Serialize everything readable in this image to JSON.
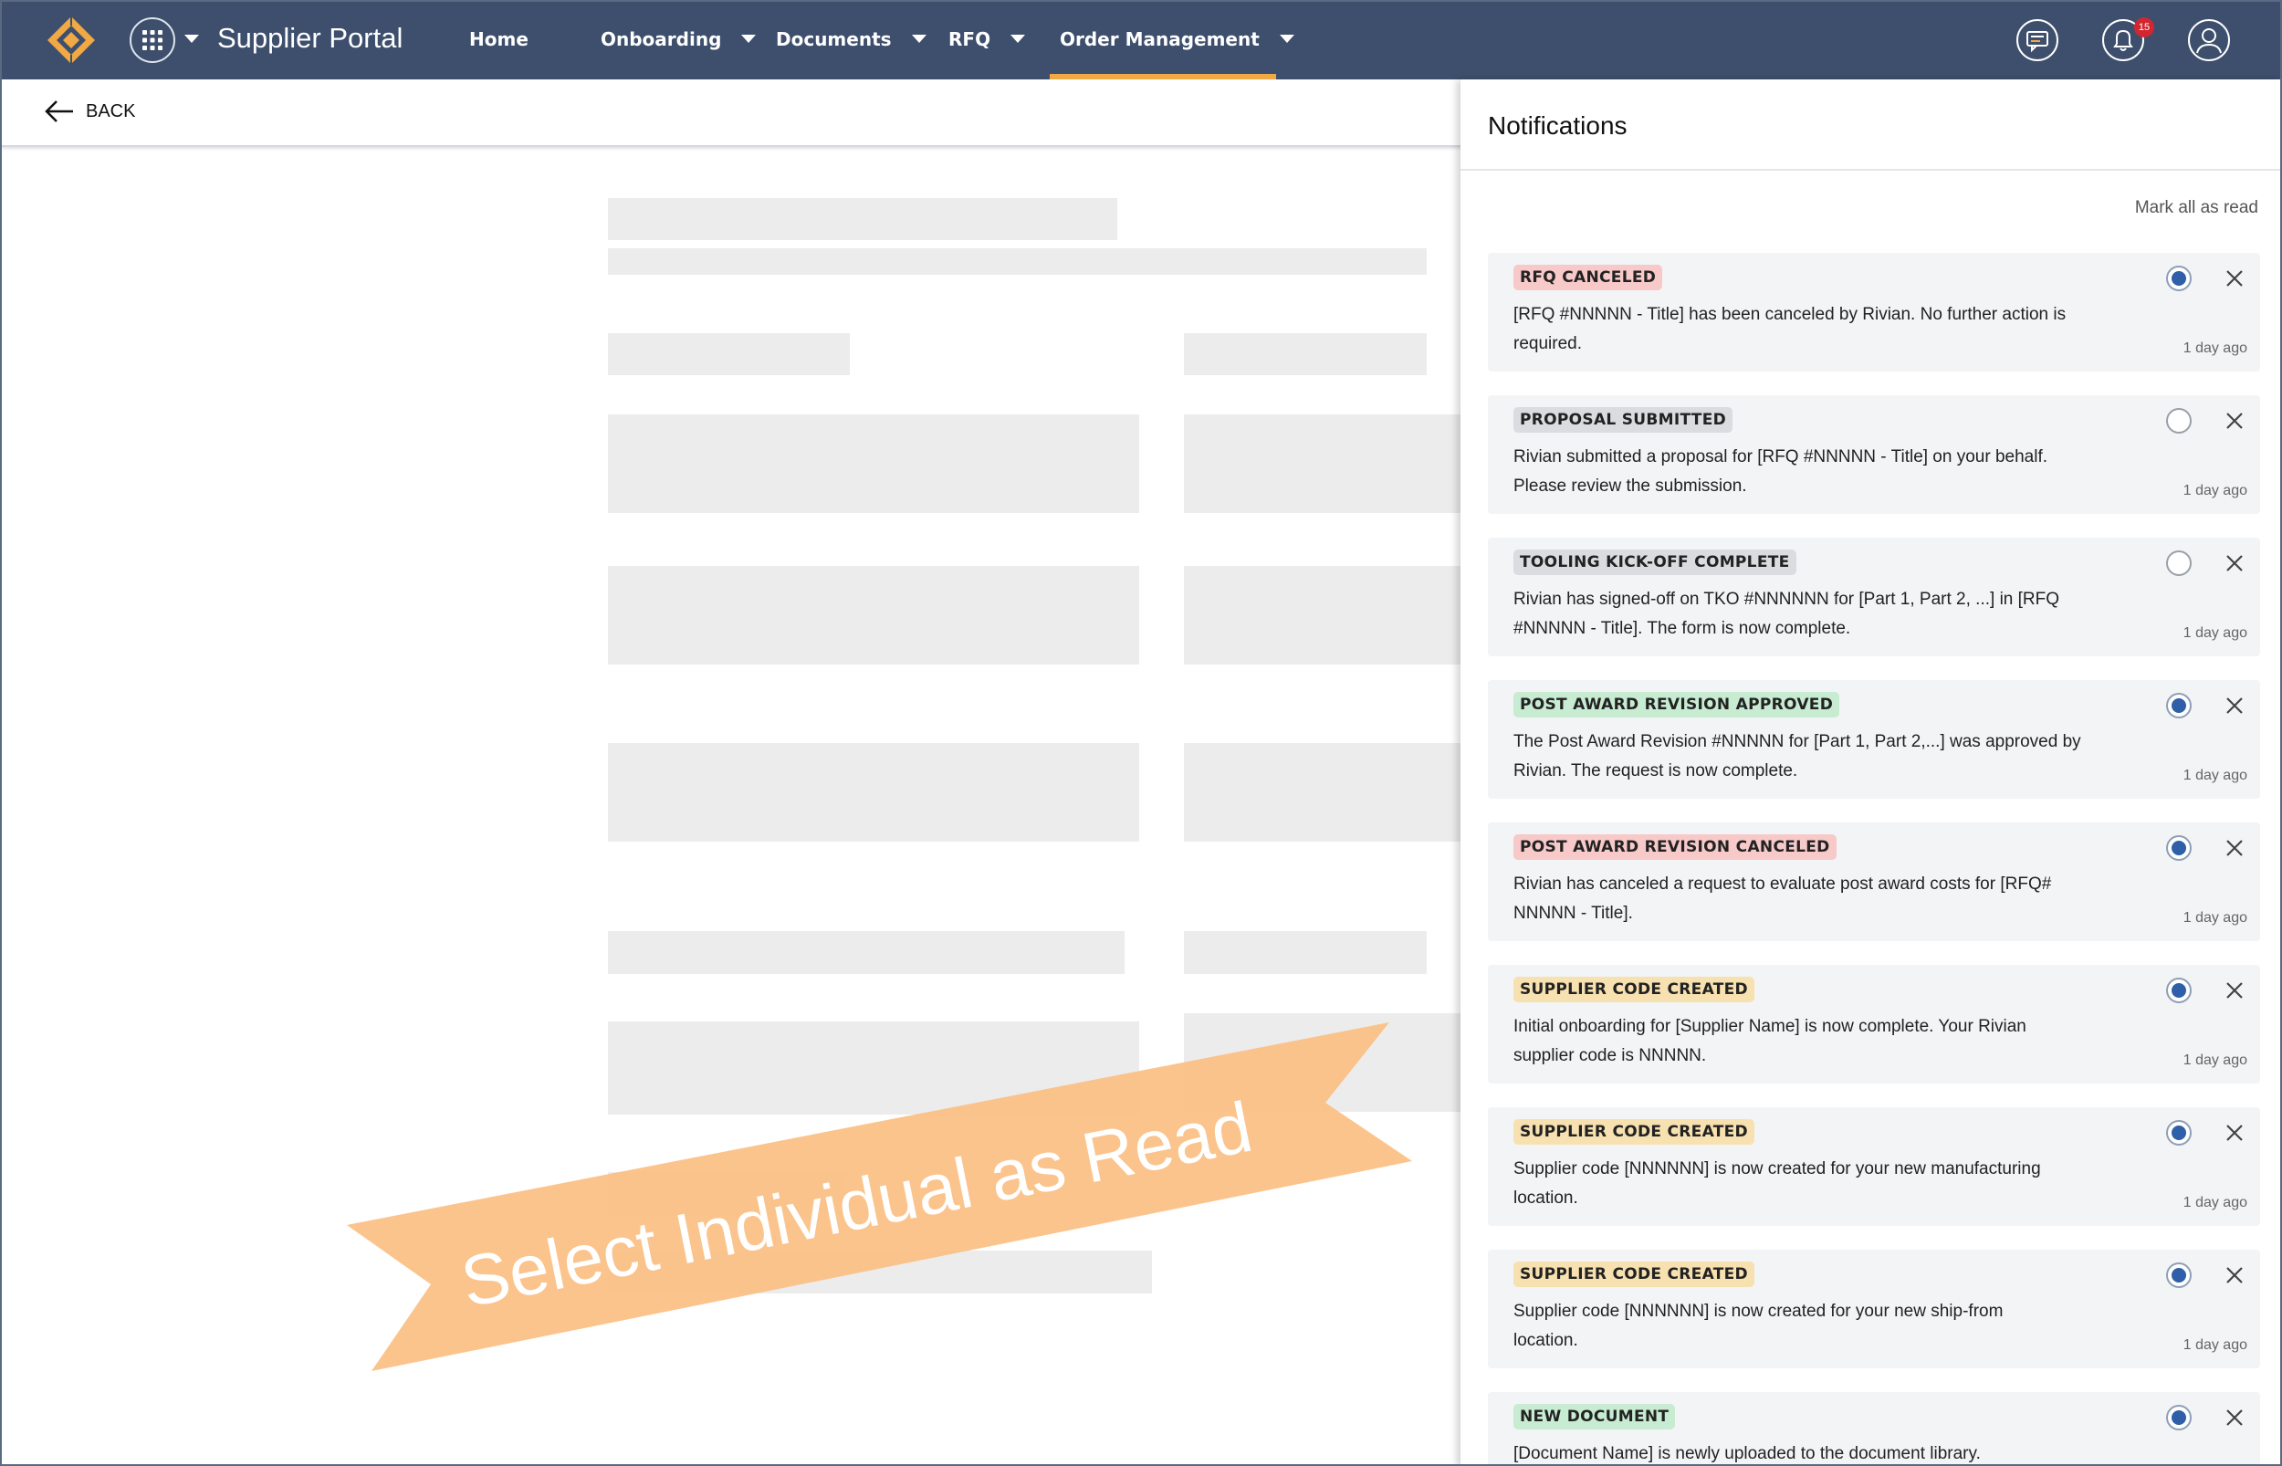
{
  "header": {
    "app_title": "Supplier Portal",
    "nav": [
      "Home",
      "Onboarding",
      "Documents",
      "RFQ",
      "Order Management"
    ],
    "notification_count": "15",
    "accent": "#f0a944",
    "bar_color": "#3d4f6c"
  },
  "subbar": {
    "back_label": "BACK"
  },
  "banner": {
    "text": "Select Individual as Read",
    "color": "#fbbf84"
  },
  "notifications": {
    "title": "Notifications",
    "mark_all": "Mark all as read",
    "items": [
      {
        "tag": "RFQ CANCELED",
        "tag_color": "#f7c9c9",
        "line1": "[RFQ #NNNNN - Title] has been canceled by Rivian. No further action is",
        "line2": "required.",
        "time": "1 day ago",
        "selected": true
      },
      {
        "tag": "PROPOSAL SUBMITTED",
        "tag_color": "#dadcdf",
        "line1": "Rivian submitted a proposal for [RFQ #NNNNN - Title] on your behalf.",
        "line2": "Please review the submission.",
        "time": "1 day ago",
        "selected": false
      },
      {
        "tag": "TOOLING KICK-OFF COMPLETE",
        "tag_color": "#dadcdf",
        "line1": "Rivian has signed-off on TKO #NNNNNN for [Part 1, Part 2, ...] in [RFQ",
        "line2": "#NNNNN - Title]. The form is now complete.",
        "time": "1 day ago",
        "selected": false
      },
      {
        "tag": "POST AWARD REVISION APPROVED",
        "tag_color": "#c8ecd2",
        "line1": "The Post Award Revision #NNNNN for [Part 1, Part 2,...] was approved by",
        "line2": "Rivian. The request is now complete.",
        "time": "1 day ago",
        "selected": true
      },
      {
        "tag": "POST AWARD REVISION CANCELED",
        "tag_color": "#f7c9c9",
        "line1": "Rivian has canceled a request to evaluate post award costs for [RFQ#",
        "line2": "NNNNN - Title].",
        "time": "1 day ago",
        "selected": true
      },
      {
        "tag": "SUPPLIER CODE CREATED",
        "tag_color": "#f8e1b0",
        "line1": "Initial onboarding for [Supplier Name] is now complete. Your Rivian",
        "line2": "supplier code is NNNNN.",
        "time": "1 day ago",
        "selected": true
      },
      {
        "tag": "SUPPLIER CODE CREATED",
        "tag_color": "#f8e1b0",
        "line1": "Supplier code [NNNNNN] is now created for your new manufacturing",
        "line2": "location.",
        "time": "1 day ago",
        "selected": true
      },
      {
        "tag": "SUPPLIER CODE CREATED",
        "tag_color": "#f8e1b0",
        "line1": "Supplier code [NNNNNN] is now created for your new ship-from",
        "line2": "location.",
        "time": "1 day ago",
        "selected": true
      },
      {
        "tag": "NEW DOCUMENT",
        "tag_color": "#c8ecd2",
        "line1": "[Document Name] is newly uploaded to the document library.",
        "line2": "",
        "time": "",
        "selected": true
      }
    ]
  }
}
